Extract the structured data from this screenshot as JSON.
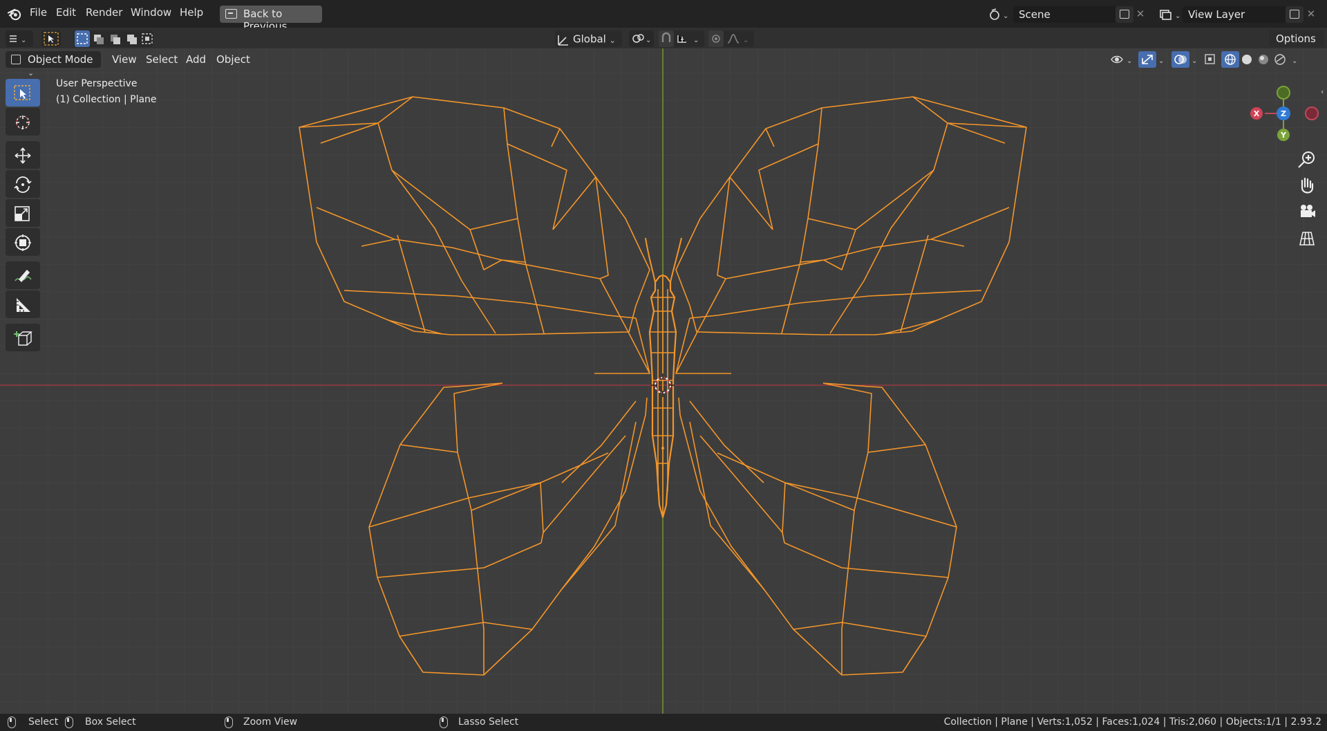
{
  "menu": {
    "file": "File",
    "edit": "Edit",
    "render": "Render",
    "window": "Window",
    "help": "Help",
    "back_to_previous": "Back to Previous"
  },
  "scene": {
    "name": "Scene"
  },
  "view_layer": {
    "name": "View Layer"
  },
  "toolbar": {
    "transform_orientation": "Global",
    "options": "Options"
  },
  "viewport": {
    "mode": "Object Mode",
    "menu": [
      "View",
      "Select",
      "Add",
      "Object"
    ],
    "perspective": "User Perspective",
    "collection": "(1) Collection | Plane"
  },
  "gizmo": {
    "x": "X",
    "y": "Y",
    "z": "Z"
  },
  "status": {
    "select": "Select",
    "box_select": "Box Select",
    "zoom_view": "Zoom View",
    "lasso_select": "Lasso Select",
    "stats": "Collection | Plane | Verts:1,052 | Faces:1,024 | Tris:2,060 | Objects:1/1 | 2.93.2"
  },
  "colors": {
    "wire": "#f4962a",
    "x_axis": "#c0485a",
    "y_axis": "#7aa43a",
    "z_axis": "#2f7bd6",
    "accent": "#476eae"
  }
}
